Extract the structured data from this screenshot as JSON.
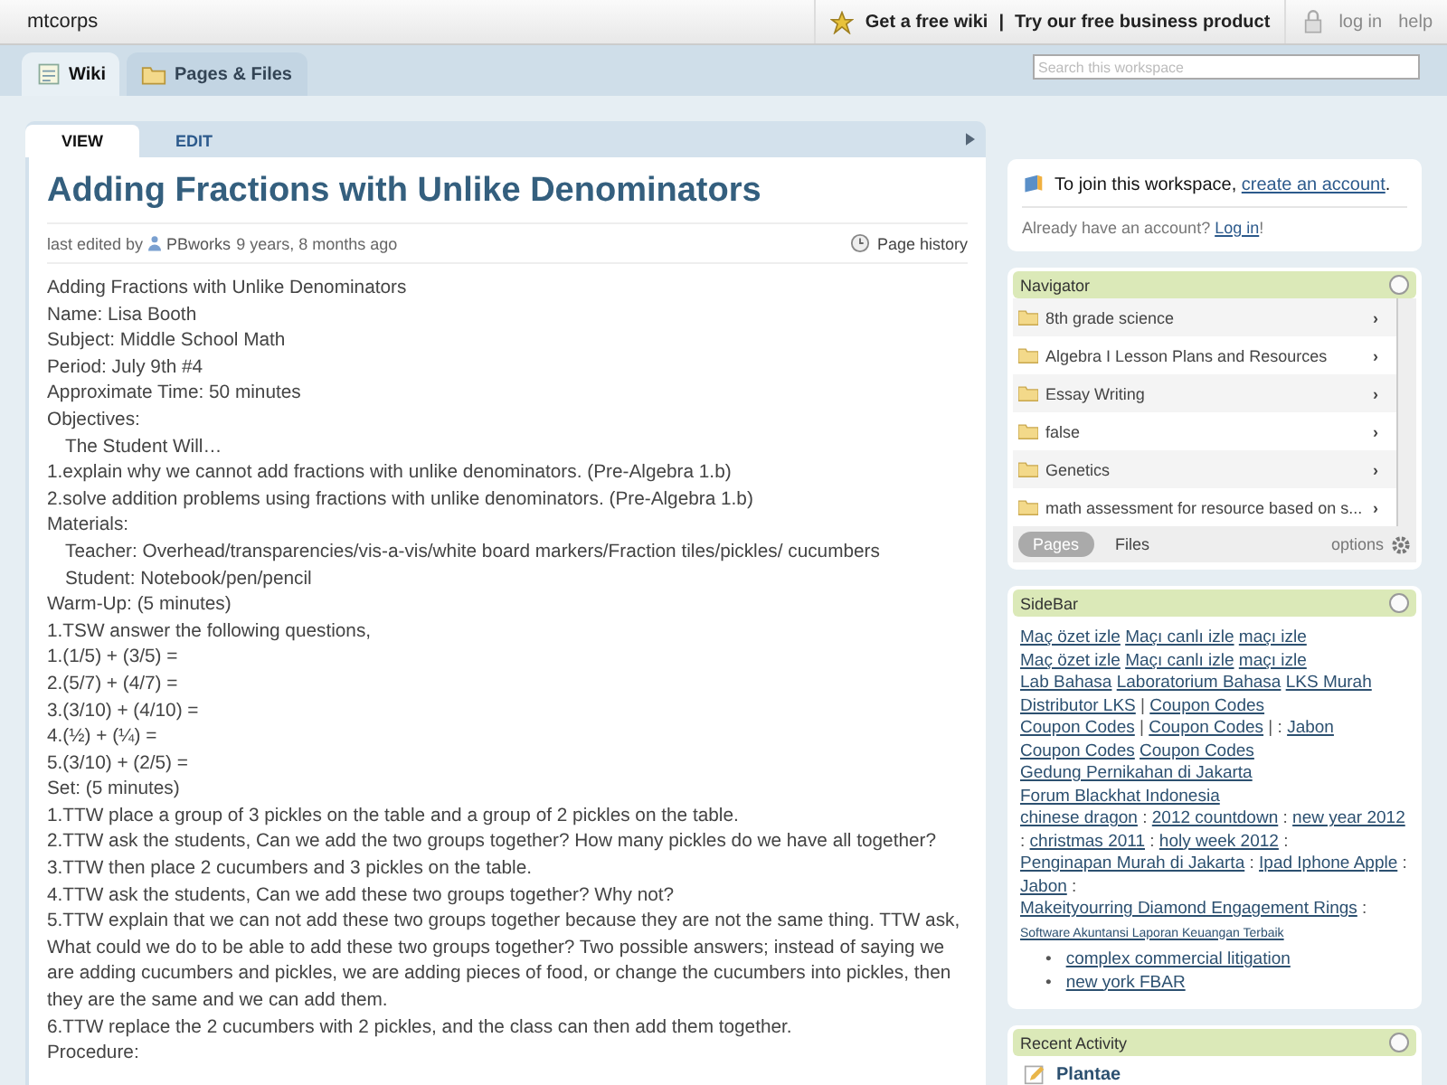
{
  "top_bar": {
    "site": "mtcorps",
    "links": [
      "Get a free wiki",
      "|",
      "Try our free business product"
    ],
    "account": [
      "log in",
      "help"
    ]
  },
  "tabs": [
    {
      "label": "Wiki",
      "selected": true
    },
    {
      "label": "Pages & Files",
      "selected": false
    }
  ],
  "search": {
    "placeholder": "Search this workspace"
  },
  "page_tabs": [
    {
      "label": "VIEW",
      "selected": true
    },
    {
      "label": "EDIT",
      "selected": false
    }
  ],
  "page": {
    "title": "Adding Fractions with Unlike Denominators",
    "edited_prefix": "last edited by",
    "editor": "PBworks",
    "edited_time": "9 years, 8 months ago",
    "history": "Page history",
    "lines": [
      {
        "text": "Adding Fractions with Unlike Denominators",
        "indent": false
      },
      {
        "text": "Name: Lisa Booth",
        "indent": false
      },
      {
        "text": "Subject: Middle School Math",
        "indent": false
      },
      {
        "text": "Period: July 9th #4",
        "indent": false
      },
      {
        "text": "Approximate Time: 50 minutes",
        "indent": false
      },
      {
        "text": "Objectives:",
        "indent": false
      },
      {
        "text": "The Student Will…",
        "indent": true
      },
      {
        "text": "1.explain why we cannot add fractions with unlike denominators.  (Pre-Algebra 1.b)",
        "indent": false
      },
      {
        "text": "2.solve addition problems using fractions with unlike denominators. (Pre-Algebra 1.b)",
        "indent": false
      },
      {
        "text": "Materials:",
        "indent": false
      },
      {
        "text": "Teacher: Overhead/transparencies/vis-a-vis/white board markers/Fraction tiles/pickles/ cucumbers",
        "indent": true
      },
      {
        "text": "Student: Notebook/pen/pencil",
        "indent": true
      },
      {
        "text": "Warm-Up: (5 minutes)",
        "indent": false
      },
      {
        "text": "1.TSW answer the following questions,",
        "indent": false
      },
      {
        "text": "1.(1/5) + (3/5) =",
        "indent": false
      },
      {
        "text": "2.(5/7) + (4/7) =",
        "indent": false
      },
      {
        "text": "3.(3/10) + (4/10) =",
        "indent": false
      },
      {
        "text": "4.(½) + (¼) =",
        "indent": false
      },
      {
        "text": "5.(3/10) + (2/5) =",
        "indent": false
      },
      {
        "text": "Set: (5 minutes)",
        "indent": false
      },
      {
        "text": "1.TTW place a group of 3 pickles on the table and a group of 2 pickles on the table.",
        "indent": false
      },
      {
        "text": "2.TTW ask the students, Can we add the two groups together?  How many pickles do we have all together?",
        "indent": false
      },
      {
        "text": "3.TTW then place 2 cucumbers and 3 pickles on the table.",
        "indent": false
      },
      {
        "text": "4.TTW ask the students, Can we add these two groups together?  Why not?",
        "indent": false
      },
      {
        "text": "5.TTW explain that we can not add these two groups together because they are not the same thing.  TTW ask, What could we do to be able to add these two groups together?  Two possible answers; instead of saying we are adding cucumbers and pickles, we are adding pieces of food, or change the cucumbers into pickles, then they are the same and we can add them.",
        "indent": false
      },
      {
        "text": "6.TTW replace the 2 cucumbers with 2 pickles, and the class can then add them together.",
        "indent": false
      },
      {
        "text": "Procedure:",
        "indent": false
      }
    ]
  },
  "join": {
    "text": "To join this workspace,",
    "link": "create an account",
    "end": ".",
    "login_text": "Already have an account?",
    "login_link": "Log in",
    "login_end": "!"
  },
  "navigator": {
    "title": "Navigator",
    "items": [
      "8th grade science",
      "Algebra I Lesson Plans and Resources",
      "Essay Writing",
      "false",
      "Genetics",
      "math assessment for resource based on s..."
    ],
    "chevron": "›",
    "tabs": [
      {
        "label": "Pages",
        "selected": true
      },
      {
        "label": "Files",
        "selected": false
      }
    ],
    "options": "options"
  },
  "sidebar": {
    "title": "SideBar",
    "segments": [
      {
        "text": "Maç özet izle",
        "kind": "link"
      },
      {
        "text": "Maçı canlı izle",
        "kind": "link"
      },
      {
        "text": "maçı izle",
        "kind": "link"
      },
      {
        "kind": "break"
      },
      {
        "text": "Maç özet izle",
        "kind": "link"
      },
      {
        "text": "Maçı canlı izle",
        "kind": "link"
      },
      {
        "text": "maçı izle",
        "kind": "link"
      },
      {
        "kind": "break"
      },
      {
        "text": "Lab Bahasa",
        "kind": "link"
      },
      {
        "text": "Laboratorium Bahasa",
        "kind": "link"
      },
      {
        "text": "LKS Murah",
        "kind": "link"
      },
      {
        "text": "Distributor LKS",
        "kind": "link"
      },
      {
        "text": "|",
        "kind": "sep"
      },
      {
        "text": "Coupon Codes",
        "kind": "link"
      },
      {
        "kind": "break"
      },
      {
        "text": "Coupon Codes",
        "kind": "link"
      },
      {
        "text": "|",
        "kind": "sep"
      },
      {
        "text": "Coupon Codes",
        "kind": "link"
      },
      {
        "text": "| :",
        "kind": "sep"
      },
      {
        "text": "Jabon",
        "kind": "link"
      },
      {
        "text": "Coupon Codes",
        "kind": "link"
      },
      {
        "text": "Coupon Codes",
        "kind": "link"
      },
      {
        "text": "Gedung Pernikahan di Jakarta",
        "kind": "link"
      },
      {
        "text": "Forum Blackhat Indonesia",
        "kind": "link"
      },
      {
        "kind": "break"
      },
      {
        "text": "chinese dragon",
        "kind": "link"
      },
      {
        "text": ":",
        "kind": "sep"
      },
      {
        "text": "2012 countdown",
        "kind": "link"
      },
      {
        "text": ":",
        "kind": "sep"
      },
      {
        "text": "new year 2012",
        "kind": "link"
      },
      {
        "text": ":",
        "kind": "sep"
      },
      {
        "text": "christmas 2011",
        "kind": "link"
      },
      {
        "text": ":",
        "kind": "sep"
      },
      {
        "text": "holy week 2012",
        "kind": "link"
      },
      {
        "text": ":",
        "kind": "sep"
      },
      {
        "text": "Penginapan Murah di Jakarta",
        "kind": "link"
      },
      {
        "text": ":",
        "kind": "sep"
      },
      {
        "text": "Ipad Iphone Apple",
        "kind": "link"
      },
      {
        "text": ":",
        "kind": "sep"
      },
      {
        "text": "Jabon",
        "kind": "link"
      },
      {
        "text": ":",
        "kind": "sep"
      },
      {
        "text": "Makeityourring Diamond Engagement Rings",
        "kind": "link"
      },
      {
        "text": ":",
        "kind": "sep"
      },
      {
        "text": "Software Akuntansi Laporan Keuangan Terbaik",
        "kind": "small"
      }
    ],
    "bullet_marker": "•",
    "bullets": [
      "complex commercial litigation",
      "new york FBAR"
    ]
  },
  "recent": {
    "title": "Recent Activity",
    "items": [
      "Plantae"
    ]
  }
}
